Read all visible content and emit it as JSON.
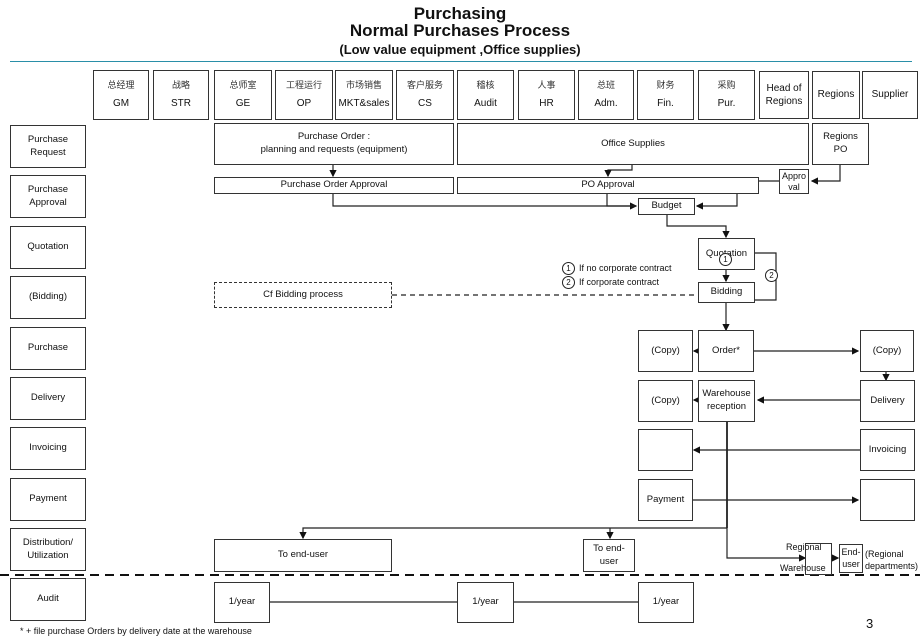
{
  "header": {
    "title": "Purchasing",
    "subtitle": "Normal Purchases Process",
    "scope": "(Low value equipment ,Office supplies)"
  },
  "departments": [
    {
      "cn": "总经理",
      "en": "GM"
    },
    {
      "cn": "战略",
      "en": "STR"
    },
    {
      "cn": "总师室",
      "en": "GE"
    },
    {
      "cn": "工程运行",
      "en": "OP"
    },
    {
      "cn": "市场销售",
      "en": "MKT&sales"
    },
    {
      "cn": "客户服务",
      "en": "CS"
    },
    {
      "cn": "稽核",
      "en": "Audit"
    },
    {
      "cn": "人事",
      "en": "HR"
    },
    {
      "cn": "总班",
      "en": "Adm."
    },
    {
      "cn": "财务",
      "en": "Fin."
    },
    {
      "cn": "采购",
      "en": "Pur."
    },
    {
      "cn": "",
      "en": "Head of Regions"
    },
    {
      "cn": "",
      "en": "Regions"
    },
    {
      "cn": "",
      "en": "Supplier"
    }
  ],
  "stages": [
    "Purchase Request",
    "Purchase Approval",
    "Quotation",
    "(Bidding)",
    "Purchase",
    "Delivery",
    "Invoicing",
    "Payment",
    "Distribution/ Utilization",
    "Audit"
  ],
  "steps": {
    "po_planning_title": "Purchase Order :",
    "po_planning_sub": "planning and requests (equipment)",
    "office_supplies": "Office Supplies",
    "regions_po": "Regions PO",
    "po_approval_equipment": "Purchase Order Approval",
    "po_approval_office": "PO Approval",
    "approval_regions": "Appro val",
    "budget": "Budget",
    "quotation": "Quotation",
    "bidding": "Bidding",
    "cf_bidding": "Cf Bidding process",
    "copy_fin_order": "(Copy)",
    "order": "Order*",
    "copy_supplier": "(Copy)",
    "copy_fin_delivery": "(Copy)",
    "warehouse_reception": "Warehouse reception",
    "delivery_supplier": "Delivery",
    "invoicing_supplier": "Invoicing",
    "payment": "Payment",
    "to_end_user_wide": "To end-user",
    "to_end_user_narrow": "To end- user",
    "regional_label_top": "Regional",
    "regional_label_bottom": "Warehouse",
    "end_user": "End- user",
    "regional_departments": "(Regional departments)",
    "audit_1": "1/year",
    "audit_2": "1/year",
    "audit_3": "1/year"
  },
  "legend": [
    {
      "num": "1",
      "label": "If no corporate contract"
    },
    {
      "num": "2",
      "label": "If corporate contract"
    }
  ],
  "footnote": "* + file purchase Orders by delivery date at the warehouse",
  "page_number": "3"
}
